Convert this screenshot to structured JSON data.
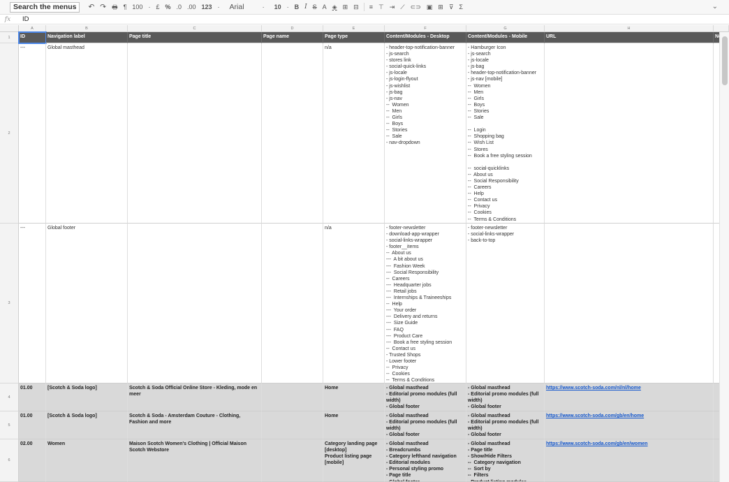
{
  "toolbar": {
    "search_menus": "Search the menus",
    "undo": "↶",
    "redo": "↷",
    "print": "🖶",
    "paint_format": "¶",
    "zoom": "100",
    "currency": "£",
    "percent": "%",
    "decimal_less": ".0",
    "decimal_more": ".00",
    "number_format": "123",
    "font": "Arial",
    "font_size": "10",
    "bold": "B",
    "italic": "I",
    "strike": "S",
    "text_color": "A",
    "fill_color": "◈",
    "borders": "⊞",
    "merge": "⊟",
    "align": "≡",
    "valign": "⊤",
    "wrap": "⇥",
    "rotate": "⟋",
    "link": "⊂⊃",
    "comment": "▣",
    "chart": "⊞",
    "filter": "⊽",
    "functions": "Σ",
    "collapse": "⌄",
    "dash": "·"
  },
  "formula_bar": {
    "fx": "fx",
    "value": "ID"
  },
  "columns": [
    "A",
    "B",
    "C",
    "D",
    "E",
    "F",
    "G",
    "H",
    ""
  ],
  "rows": [
    "1",
    "2",
    "3",
    "4",
    "5",
    "6"
  ],
  "header_cells": [
    "ID",
    "Navigation label",
    "Page title",
    "Page name",
    "Page type",
    "Content/Modules - Desktop",
    "Content/Modules - Mobile",
    "URL",
    "Note"
  ],
  "row2": {
    "id": "---",
    "nav": "Global masthead",
    "type": "n/a",
    "desktop": "- header-top-notification-banner\n- js-search\n- stores link\n- social-quick-links\n- js-locale\n- js-login-flyout\n- js-wishlist\n- js-bag\n- js-nav\n--  Women\n--  Men\n--  Girls\n--  Boys\n--  Stories\n--  Sale\n- nav-dropdown",
    "mobile": "- Hamburger Icon\n- js-search\n- js-locale\n- js-bag\n- header-top-notification-banner\n- js-nav [mobile]\n--  Women\n--  Men\n--  Girls\n--  Boys\n--  Stories\n--  Sale\n\n--  Login\n--  Shopping bag\n--  Wish List\n--  Stores\n--  Book a free styling session\n\n--  social-quicklinks\n--  About us\n--  Social Responsibility\n--  Careers\n--  Help\n--  Contact us\n--  Privacy\n--  Cookies\n--  Terms & Conditions"
  },
  "row3": {
    "id": "---",
    "nav": "Global footer",
    "type": "n/a",
    "desktop": "- footer-newsletter\n- download-app-wrapper\n- social-links-wrapper\n- footer__items\n--  About us\n---  A bit about us\n---  Fashion Week\n---  Social Responsibility\n--  Careers\n---  Headquarter jobs\n---  Retail jobs\n---  Internships & Traineeships\n--  Help\n---  Your order\n---  Delivery and returns\n---  Size Guide\n---  FAQ\n---  Product Care\n---  Book a free styling session\n--  Contact us\n- Trusted Shops\n- Lower footer\n--  Privacy\n--  Cookies\n--  Terms & Conditions",
    "mobile": "- footer-newsletter\n- social-links-wrapper\n- back-to-top"
  },
  "row4": {
    "id": "01.00",
    "nav": "[Scotch & Soda logo]",
    "title": "Scotch & Soda Official Online Store - Kleding, mode en meer",
    "type": "Home",
    "desktop": "- Global masthead\n- Editorial promo modules (full width)\n- Global footer",
    "mobile": "- Global masthead\n- Editorial promo modules (full width)\n- Global footer",
    "url": "https://www.scotch-soda.com/nl/nl/home"
  },
  "row5": {
    "id": "01.00",
    "nav": "[Scotch & Soda logo]",
    "title": "Scotch & Soda - Amsterdam Couture - Clothing, Fashion and more",
    "type": "Home",
    "desktop": "- Global masthead\n- Editorial promo modules (full width)\n- Global footer",
    "mobile": "- Global masthead\n- Editorial promo modules (full width)\n- Global footer",
    "url": "https://www.scotch-soda.com/gb/en/home"
  },
  "row6": {
    "id": "02.00",
    "nav": "Women",
    "title": "Maison Scotch Women's Clothing | Official Maison Scotch Webstore",
    "type": "Category landing page [desktop]\nProduct listing page [mobile]",
    "desktop": "- Global masthead\n- Breadcrumbs\n- Category lefthand navigation\n- Editorial modules\n- Personal styling promo\n- Page title\n- Global footer",
    "mobile": "- Global masthead\n- Page title\n- Show/Hide Filters\n--  Category navigation\n--  Sort by\n--  Filters\n- Product listing modules",
    "url": "https://www.scotch-soda.com/gb/en/women"
  }
}
